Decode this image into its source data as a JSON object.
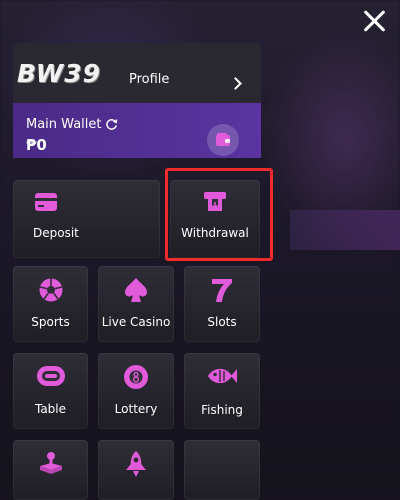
{
  "header": {
    "close_icon": "close-icon"
  },
  "profile": {
    "logo_text": "BW39",
    "label": "Profile",
    "arrow_icon": "chevron-right-icon"
  },
  "wallet": {
    "label": "Main Wallet",
    "amount": "₱0",
    "refresh_icon": "refresh-icon",
    "wallet_icon": "wallet-icon"
  },
  "actions": [
    {
      "label": "Deposit",
      "icon": "card-icon"
    },
    {
      "label": "Withdrawal",
      "icon": "atm-icon"
    }
  ],
  "menu": [
    {
      "label": "Sports",
      "icon": "soccer-ball-icon"
    },
    {
      "label": "Live Casino",
      "icon": "spade-icon"
    },
    {
      "label": "Slots",
      "icon": "seven-icon"
    },
    {
      "label": "Table",
      "icon": "chip-icon"
    },
    {
      "label": "Lottery",
      "icon": "eight-ball-icon"
    },
    {
      "label": "Fishing",
      "icon": "fish-icon"
    }
  ],
  "colors": {
    "accent": "#e05ad9",
    "wallet_bg": "#4b2a87",
    "highlight": "#ef2b2b"
  }
}
